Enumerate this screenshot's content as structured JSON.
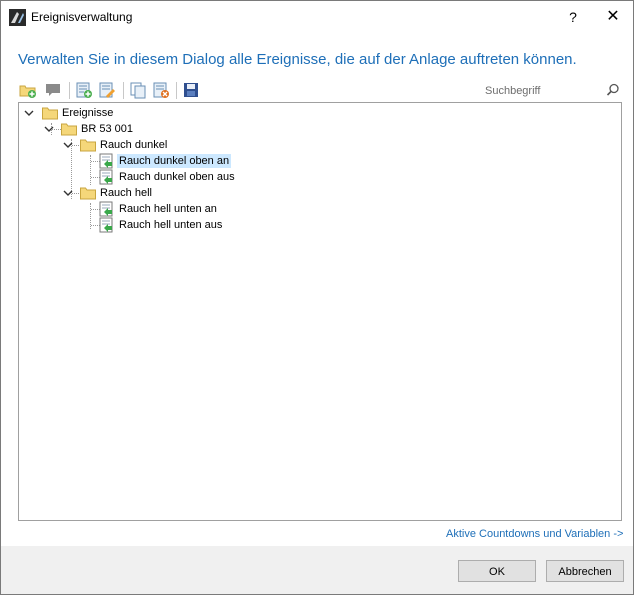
{
  "window": {
    "title": "Ereignisverwaltung",
    "help_label": "?",
    "close_label": "✕"
  },
  "heading": "Verwalten Sie in diesem Dialog alle Ereignisse, die auf der Anlage auftreten können.",
  "toolbar": {
    "buttons": [
      "add-folder-icon",
      "comment-icon",
      "add-event-icon",
      "edit-event-icon",
      "copy-icon",
      "delete-icon",
      "save-icon"
    ]
  },
  "search": {
    "placeholder": "Suchbegriff",
    "value": ""
  },
  "tree": {
    "root": "Ereignisse",
    "loco": "BR 53 001",
    "group1": {
      "label": "Rauch dunkel",
      "items": [
        "Rauch dunkel oben an",
        "Rauch dunkel oben aus"
      ],
      "selected_index": 0
    },
    "group2": {
      "label": "Rauch hell",
      "items": [
        "Rauch hell unten an",
        "Rauch hell unten aus"
      ]
    }
  },
  "link_text": "Aktive Countdowns und Variablen ->",
  "buttons": {
    "ok": "OK",
    "cancel": "Abbrechen"
  },
  "colors": {
    "accent": "#1e6fb8",
    "selection": "#cce8ff",
    "folder": "#f5d77a"
  }
}
